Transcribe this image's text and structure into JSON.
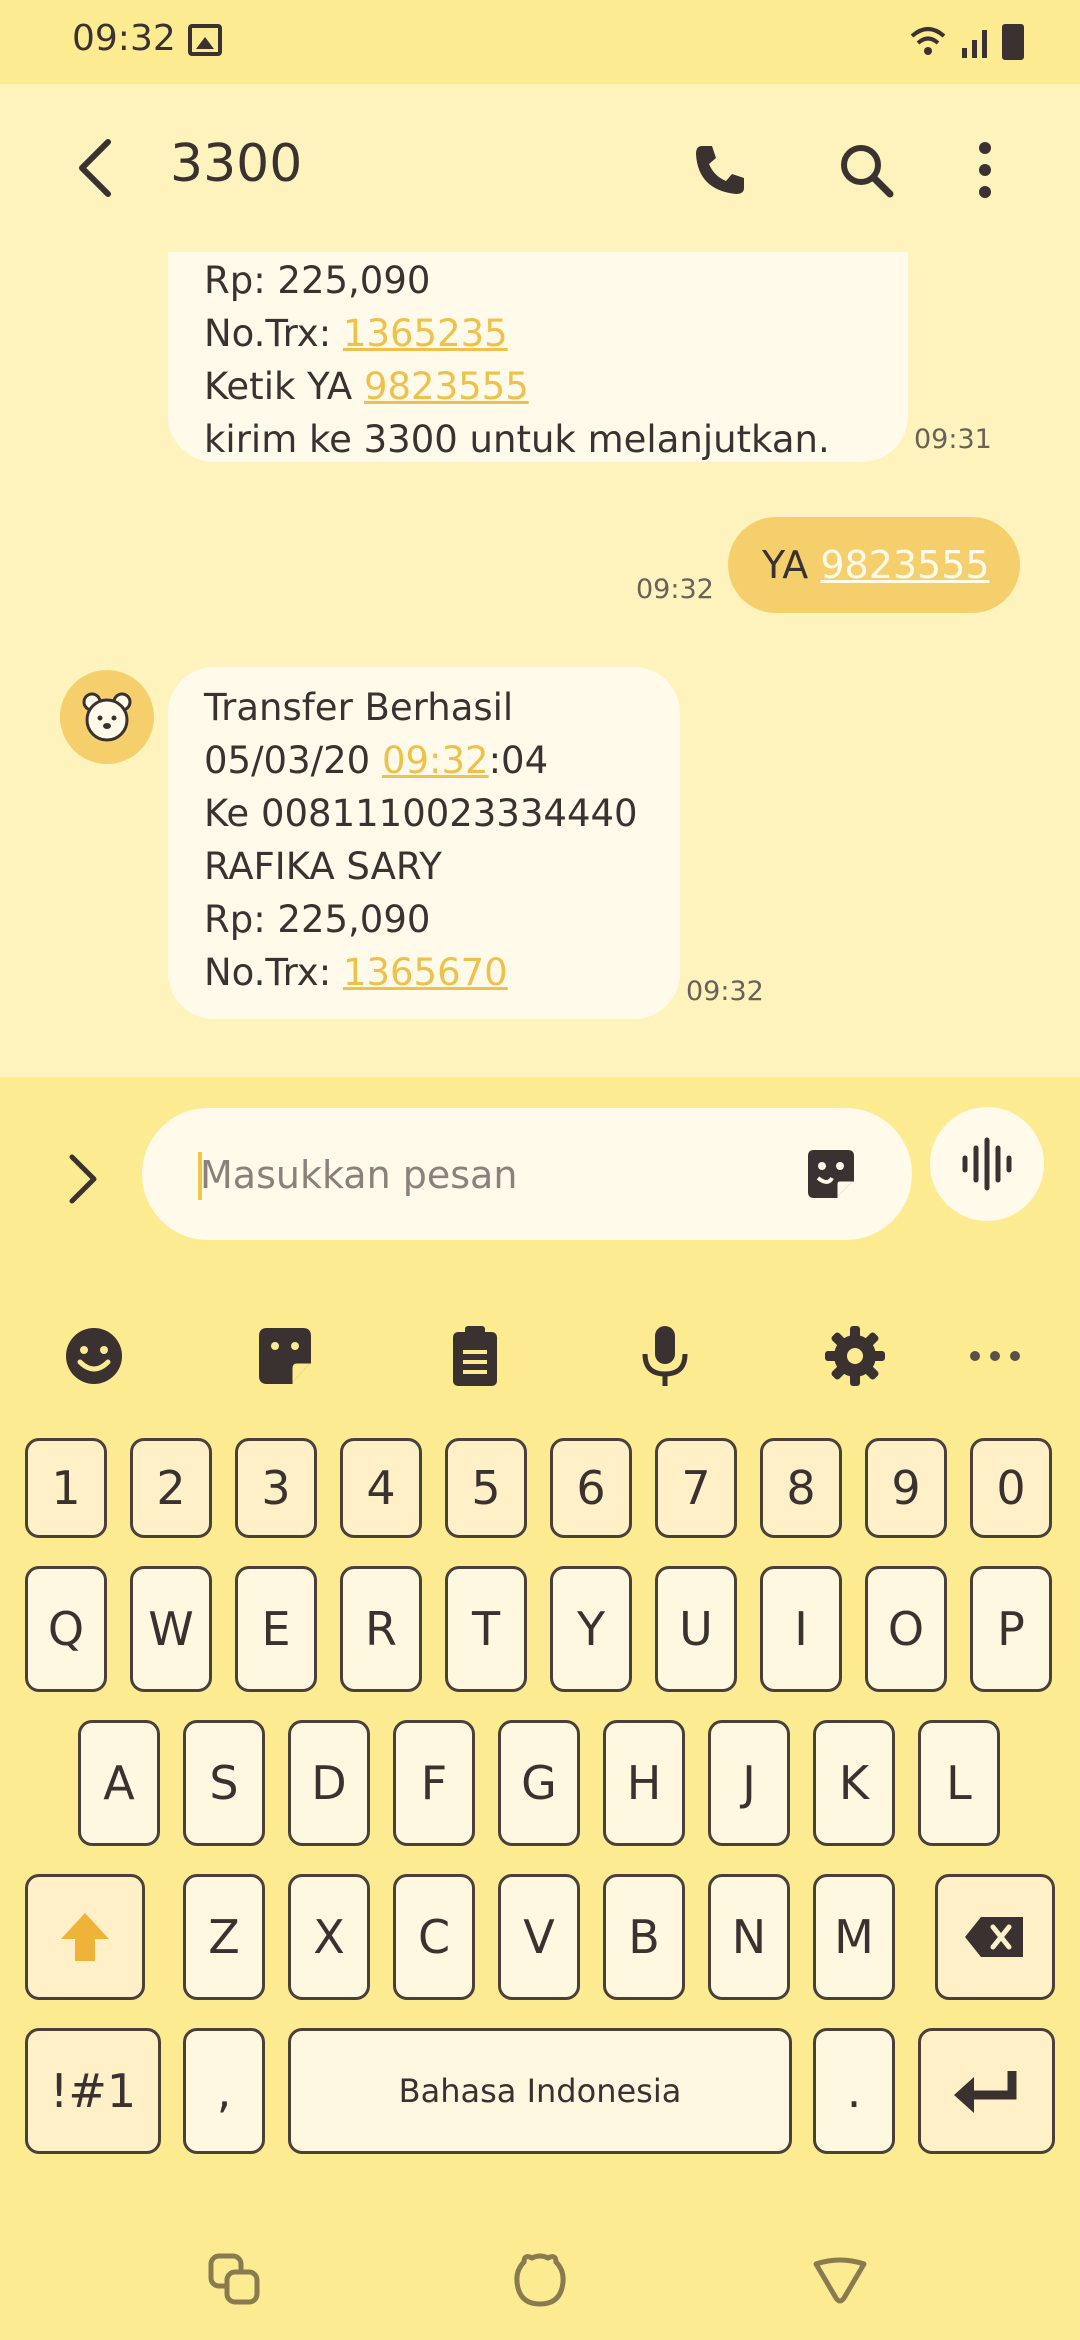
{
  "status": {
    "time": "09:32"
  },
  "header": {
    "title": "3300"
  },
  "messages": {
    "m1": {
      "line1": "Rp: 225,090",
      "line2_prefix": "No.Trx: ",
      "line2_link": "1365235",
      "line3_prefix": "Ketik YA ",
      "line3_link": "9823555",
      "line4": "kirim ke 3300 untuk melanjutkan.",
      "time": "09:31"
    },
    "m2": {
      "prefix": "YA ",
      "link": "9823555",
      "time": "09:32"
    },
    "m3": {
      "line1": "Transfer Berhasil",
      "line2_prefix": "05/03/20 ",
      "line2_link": "09:32",
      "line2_suffix": ":04",
      "line3": "Ke 0081110023334440",
      "line4": "RAFIKA SARY",
      "line5": "Rp: 225,090",
      "line6_prefix": "No.Trx: ",
      "line6_link": "1365670",
      "time": "09:32"
    }
  },
  "composer": {
    "placeholder": "Masukkan pesan"
  },
  "keyboard": {
    "numbers": [
      "1",
      "2",
      "3",
      "4",
      "5",
      "6",
      "7",
      "8",
      "9",
      "0"
    ],
    "row1": [
      "Q",
      "W",
      "E",
      "R",
      "T",
      "Y",
      "U",
      "I",
      "O",
      "P"
    ],
    "row2": [
      "A",
      "S",
      "D",
      "F",
      "G",
      "H",
      "J",
      "K",
      "L"
    ],
    "row3": [
      "Z",
      "X",
      "C",
      "V",
      "B",
      "N",
      "M"
    ],
    "symbols_label": "!#1",
    "comma": ",",
    "space_label": "Bahasa Indonesia",
    "period": "."
  },
  "colors": {
    "accent": "#f6cf6d",
    "link": "#f0c14a",
    "background": "#fef3bd",
    "bar": "#fdeb91"
  }
}
